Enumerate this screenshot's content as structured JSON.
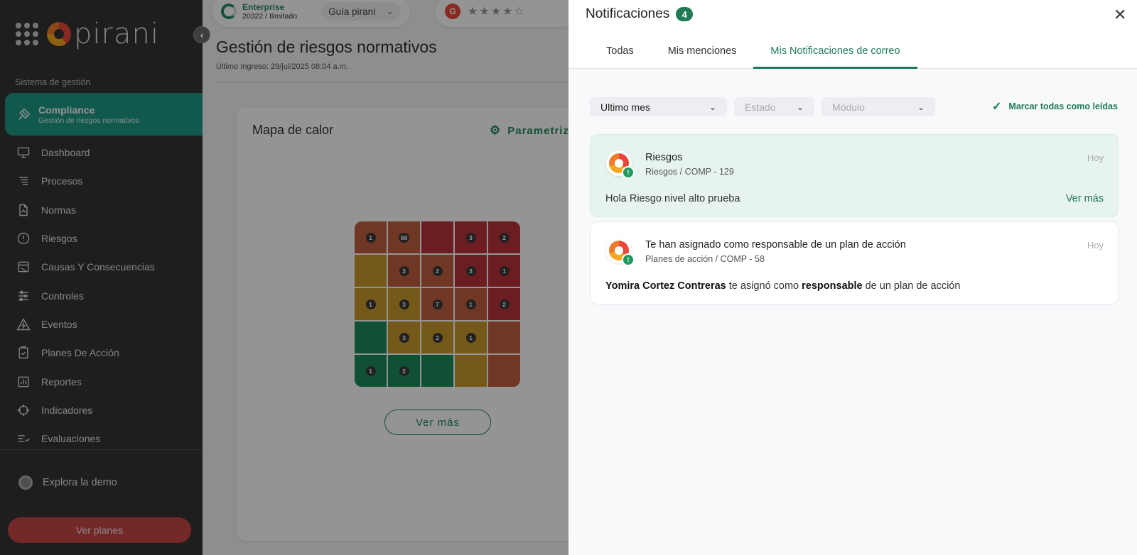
{
  "sidebar": {
    "logo_text": "pirani",
    "section_label": "Sistema de gestión",
    "active_module": {
      "title": "Compliance",
      "subtitle": "Gestión de riesgos normativos"
    },
    "items": [
      {
        "label": "Dashboard",
        "icon": "monitor-icon"
      },
      {
        "label": "Procesos",
        "icon": "process-list-icon"
      },
      {
        "label": "Normas",
        "icon": "document-icon"
      },
      {
        "label": "Riesgos",
        "icon": "alert-circle-icon"
      },
      {
        "label": "Causas Y Consecuencias",
        "icon": "cause-box-icon"
      },
      {
        "label": "Controles",
        "icon": "sliders-icon"
      },
      {
        "label": "Eventos",
        "icon": "warning-triangle-icon"
      },
      {
        "label": "Planes De Acción",
        "icon": "clipboard-check-icon"
      },
      {
        "label": "Reportes",
        "icon": "bar-chart-icon"
      },
      {
        "label": "Indicadores",
        "icon": "crosshair-icon"
      },
      {
        "label": "Evaluaciones",
        "icon": "checklist-icon"
      }
    ],
    "demo_label": "Explora la demo",
    "plans_button": "Ver planes"
  },
  "topbar": {
    "plan_name": "Enterprise",
    "plan_detail": "20322 / Ilimitado",
    "guide_label": "Guía pirani",
    "rating_stars": "★★★★☆"
  },
  "main": {
    "page_title": "Gestión de riesgos normativos",
    "last_login": "Último Ingreso: 29/jul/2025 08:04 a.m.",
    "heatmap": {
      "title": "Mapa de calor",
      "param_label": "Parametriz",
      "see_more": "Ver más",
      "rows": [
        [
          {
            "v": "1",
            "c": "#c2603f"
          },
          {
            "v": "68",
            "c": "#c2603f"
          },
          {
            "v": "",
            "c": "#b9333a"
          },
          {
            "v": "3",
            "c": "#b9333a"
          },
          {
            "v": "2",
            "c": "#b9333a"
          }
        ],
        [
          {
            "v": "",
            "c": "#c99a2c"
          },
          {
            "v": "3",
            "c": "#c2603f"
          },
          {
            "v": "2",
            "c": "#c2603f"
          },
          {
            "v": "3",
            "c": "#b9333a"
          },
          {
            "v": "1",
            "c": "#b9333a"
          }
        ],
        [
          {
            "v": "1",
            "c": "#c99a2c"
          },
          {
            "v": "3",
            "c": "#c99a2c"
          },
          {
            "v": "7",
            "c": "#c2603f"
          },
          {
            "v": "1",
            "c": "#c2603f"
          },
          {
            "v": "2",
            "c": "#b9333a"
          }
        ],
        [
          {
            "v": "",
            "c": "#1c8a5c"
          },
          {
            "v": "3",
            "c": "#c99a2c"
          },
          {
            "v": "2",
            "c": "#c99a2c"
          },
          {
            "v": "1",
            "c": "#c99a2c"
          },
          {
            "v": "",
            "c": "#c2603f"
          }
        ],
        [
          {
            "v": "1",
            "c": "#1c8a5c"
          },
          {
            "v": "2",
            "c": "#1c8a5c"
          },
          {
            "v": "",
            "c": "#1c8a5c"
          },
          {
            "v": "",
            "c": "#c99a2c"
          },
          {
            "v": "",
            "c": "#c2603f"
          }
        ]
      ]
    }
  },
  "notifications": {
    "title": "Notificaciones",
    "count": "4",
    "tabs": [
      {
        "label": "Todas",
        "active": false
      },
      {
        "label": "Mis menciones",
        "active": false
      },
      {
        "label": "Mis Notificaciones de correo",
        "active": true
      }
    ],
    "filters": {
      "period": "Ultimo mes",
      "status_placeholder": "Estado",
      "module_placeholder": "Módulo"
    },
    "mark_all": "Marcar todas como leídas",
    "items": [
      {
        "title": "Riesgos",
        "subtitle": "Riesgos / COMP - 129",
        "time": "Hoy",
        "body": "Hola Riesgo nivel alto prueba",
        "more": "Ver más"
      },
      {
        "title": "Te han asignado como responsable de un plan de acción",
        "subtitle": "Planes de acción / COMP - 58",
        "time": "Hoy",
        "body_user": "Yomira Cortez Contreras",
        "body_mid": " te asignó como ",
        "body_role": "responsable",
        "body_end": " de un plan de acción"
      }
    ]
  }
}
